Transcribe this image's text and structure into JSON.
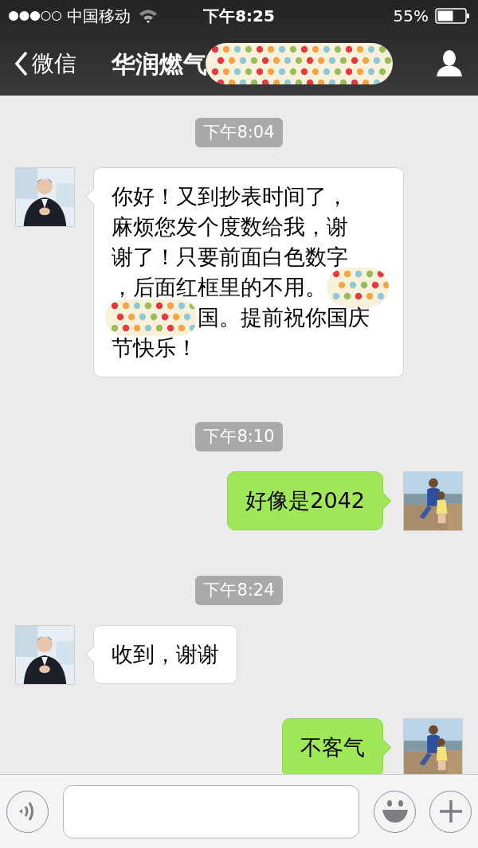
{
  "status_bar": {
    "carrier": "中国移动",
    "time": "下午8:25",
    "battery": "55%"
  },
  "nav_bar": {
    "back": "微信",
    "title": "华润燃气"
  },
  "messages": [
    {
      "kind": "time",
      "text": "下午8:04"
    },
    {
      "kind": "incoming",
      "lines": [
        {
          "text": "你好！又到抄表时间了，"
        },
        {
          "text": "麻烦您发个度数给我，谢"
        },
        {
          "text": "谢了！只要前面白色数字"
        },
        {
          "text": "，后面红框里的不用。",
          "redacted_after": true
        },
        {
          "text": "国。提前祝你国庆",
          "redacted_before": true
        },
        {
          "text": "节快乐！"
        }
      ]
    },
    {
      "kind": "time",
      "text": "下午8:10"
    },
    {
      "kind": "outgoing",
      "lines": [
        {
          "text": "好像是2042"
        }
      ]
    },
    {
      "kind": "time",
      "text": "下午8:24"
    },
    {
      "kind": "incoming",
      "lines": [
        {
          "text": "收到，谢谢"
        }
      ]
    },
    {
      "kind": "outgoing",
      "lines": [
        {
          "text": "不客气"
        }
      ]
    }
  ]
}
